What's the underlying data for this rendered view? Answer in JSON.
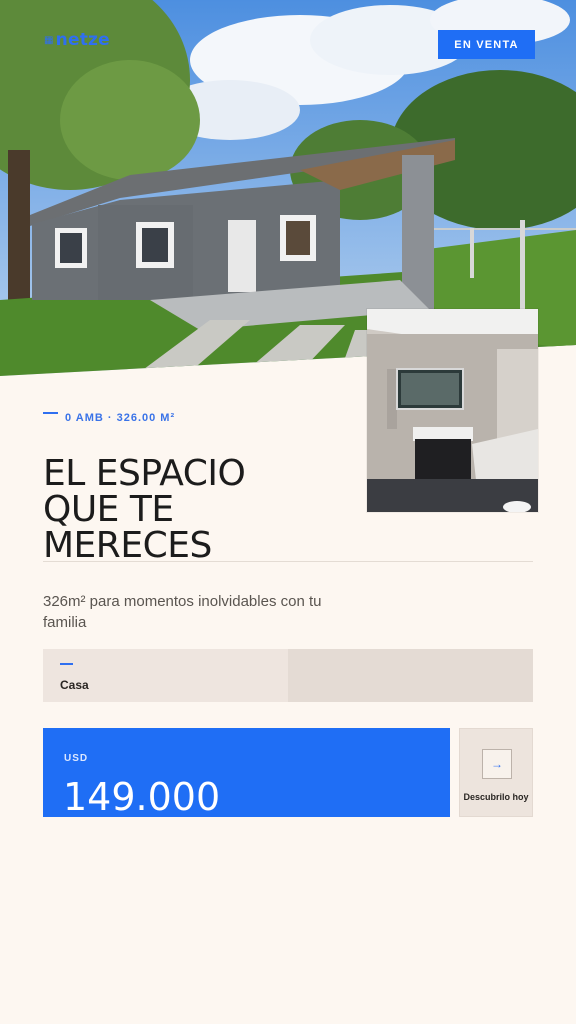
{
  "brand": {
    "logo_text": "netze"
  },
  "badge": {
    "label": "EN VENTA"
  },
  "listing": {
    "meta": "0 AMB · 326.00 M²",
    "title_lines": [
      "EL ESPACIO",
      "QUE TE",
      "MERECES"
    ],
    "subtitle": "326m² para momentos inolvidables con tu familia",
    "type_label": "Casa"
  },
  "price": {
    "currency": "USD",
    "amount": "149.000"
  },
  "cta": {
    "label": "Descubrilo hoy",
    "icon": "arrow-right-icon"
  },
  "colors": {
    "accent": "#1f6ef5",
    "background": "#fdf7f1"
  }
}
